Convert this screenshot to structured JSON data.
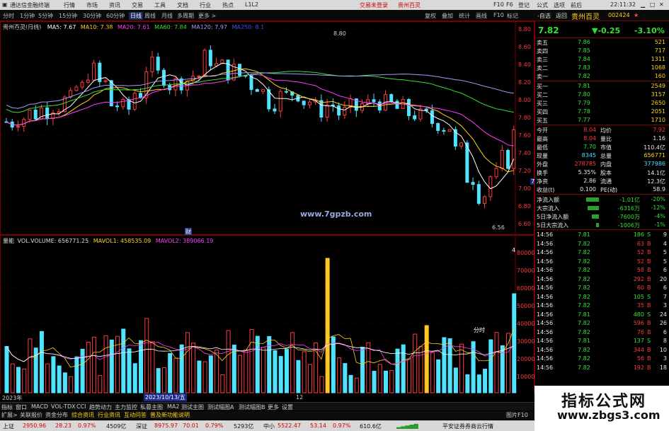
{
  "titlebar": {
    "app_name": "通达信金融终端",
    "menus": [
      "行情",
      "市场",
      "资讯",
      "交易",
      "工具",
      "文档",
      "行业",
      "热点",
      "L1L2"
    ],
    "login_link": "交易未登录",
    "stock_link": "贵州百灵",
    "right_menus": [
      "F10",
      "F6",
      "登记",
      "公式",
      "选项",
      "前后"
    ]
  },
  "periodbar": {
    "periods": [
      "分时",
      "1分钟",
      "5分钟",
      "15分钟",
      "30分钟",
      "60分钟",
      "日线",
      "周线",
      "月线",
      "多周期",
      "更多 >"
    ],
    "selected": "日线"
  },
  "right_top_bar": {
    "items": [
      "复权",
      "叠加",
      "统计",
      "画线",
      "F10",
      "标记",
      "-自选",
      "返回"
    ]
  },
  "main_chart": {
    "stock_label": "贵州百灵(日线)",
    "ma5": "MA5: 7.67",
    "ma10": "MA10: 7.38",
    "ma20": "MA20: 7.61",
    "ma60": "MA60: 7.84",
    "ma120": "MA120: 7.97",
    "ma250": "MA250: 8.1",
    "high_label": "8.80",
    "low_label": "6.56",
    "price_tag": "7.02",
    "marker_text": "财",
    "watermark": "www.7gpzb.com"
  },
  "axis_prices": [
    "8.80",
    "8.60",
    "8.40",
    "8.20",
    "8.00",
    "7.80",
    "7.60",
    "7.40",
    "7.20",
    "7.00",
    "6.80",
    "6.60"
  ],
  "vol_chart": {
    "legend_prefix": "量能",
    "volume": "VOL.VOLUME: 656771.25",
    "mavol1": "MAVOL1: 458535.09",
    "mavol2": "MAVOL2: 389066.19",
    "note_label": "分时",
    "spike_labels": [
      "4"
    ],
    "axis": [
      "80000",
      "70000",
      "60000",
      "50000",
      "40000",
      "30000",
      "20000",
      "10000"
    ]
  },
  "bottom_axis": {
    "left_year": "2023年",
    "date_highlight": "2023/10/13/五",
    "right_label": "12"
  },
  "tabs_row1": [
    "指标",
    "窗口",
    "MACD",
    "VOL-TDX",
    "CCI",
    "趋势动力",
    "主力监控",
    "私募主图",
    "MA2",
    "测试主图",
    "测试幅图A",
    "测试幅图B",
    "更多",
    "设置"
  ],
  "tabs_row2": [
    "扩展>",
    "关联报价",
    "资金分布",
    "综合资讯",
    "行业资讯",
    "互动问答",
    "普及新功能说明"
  ],
  "tabs_row2_right": "图片F10",
  "quote": {
    "name": "贵州百灵",
    "code": "002424",
    "price": "7.82",
    "change": "▼-0.25",
    "pct": "-3.10%",
    "asks": [
      {
        "label": "卖五",
        "price": "7.86",
        "vol": "521"
      },
      {
        "label": "卖四",
        "price": "7.85",
        "vol": "717"
      },
      {
        "label": "卖三",
        "price": "7.84",
        "vol": "1311"
      },
      {
        "label": "卖二",
        "price": "7.83",
        "vol": "1068"
      },
      {
        "label": "卖一",
        "price": "7.82",
        "vol": "160"
      }
    ],
    "bids": [
      {
        "label": "买一",
        "price": "7.81",
        "vol": "2549"
      },
      {
        "label": "买二",
        "price": "7.80",
        "vol": "3157"
      },
      {
        "label": "买三",
        "price": "7.79",
        "vol": "2650"
      },
      {
        "label": "买四",
        "price": "7.78",
        "vol": "2051"
      },
      {
        "label": "买五",
        "price": "7.77",
        "vol": "1710"
      }
    ],
    "stats": [
      {
        "l1": "今开",
        "v1": "8.04",
        "l2": "均价",
        "v2": "7.92"
      },
      {
        "l1": "最高",
        "v1": "8.04",
        "l2": "量比",
        "v2": "1.16"
      },
      {
        "l1": "最低",
        "v1": "7.70",
        "l2": "市值",
        "v2": "110.4亿"
      },
      {
        "l1": "现量",
        "v1": "8345",
        "l2": "总量",
        "v2": "656771"
      },
      {
        "l1": "外盘",
        "v1": "278785",
        "l2": "内盘",
        "v2": "377986"
      },
      {
        "l1": "换手",
        "v1": "5.35%",
        "l2": "股本",
        "v2": "14.1亿"
      },
      {
        "l1": "净资",
        "v1": "2.86",
        "l2": "流通",
        "v2": "12.3亿"
      },
      {
        "l1": "收益(t)",
        "v1": "0.100",
        "l2": "PE(动)",
        "v2": "58.9"
      }
    ],
    "flows": [
      {
        "label": "净流入额",
        "value": "-1.01亿",
        "pct": "-20%"
      },
      {
        "label": "大宗流入",
        "value": "-6316万",
        "pct": "-12%"
      },
      {
        "label": "5日净流入额",
        "value": "-7600万",
        "pct": "-4%"
      },
      {
        "label": "5日大宗流入",
        "value": "-1006万",
        "pct": "-1%"
      }
    ],
    "ticks": [
      {
        "t": "14:56",
        "p": "7.81",
        "v": "186",
        "d": "S",
        "n": "9"
      },
      {
        "t": "14:56",
        "p": "7.82",
        "v": "63",
        "d": "B",
        "n": "4"
      },
      {
        "t": "14:56",
        "p": "7.82",
        "v": "52",
        "d": "B",
        "n": "5"
      },
      {
        "t": "14:56",
        "p": "7.82",
        "v": "52",
        "d": "B",
        "n": "5"
      },
      {
        "t": "14:56",
        "p": "7.82",
        "v": "58",
        "d": "B",
        "n": "6"
      },
      {
        "t": "14:56",
        "p": "7.82",
        "v": "292",
        "d": "B",
        "n": "20"
      },
      {
        "t": "14:56",
        "p": "7.82",
        "v": "60",
        "d": "B",
        "n": "6"
      },
      {
        "t": "14:56",
        "p": "7.82",
        "v": "105",
        "d": "S",
        "n": "7"
      },
      {
        "t": "14:56",
        "p": "7.82",
        "v": "35",
        "d": "B",
        "n": "3"
      },
      {
        "t": "14:56",
        "p": "7.81",
        "v": "480",
        "d": "S",
        "n": "24"
      },
      {
        "t": "14:56",
        "p": "7.82",
        "v": "596",
        "d": "B",
        "n": "26"
      },
      {
        "t": "14:56",
        "p": "7.82",
        "v": "76",
        "d": "B",
        "n": "6"
      },
      {
        "t": "14:56",
        "p": "7.81",
        "v": "137",
        "d": "S",
        "n": "8"
      },
      {
        "t": "14:56",
        "p": "7.82",
        "v": "344",
        "d": "B",
        "n": "10"
      },
      {
        "t": "14:56",
        "p": "7.82",
        "v": "56",
        "d": "B",
        "n": "3"
      },
      {
        "t": "14:56",
        "p": "7.82",
        "v": "192",
        "d": "B",
        "n": "18"
      }
    ]
  },
  "status": {
    "sh_label": "上证",
    "sh_val": "2950.96",
    "sh_chg": "28.23",
    "sh_pct": "0.97%",
    "sh_amt": "4509亿",
    "sz_label": "深证",
    "sz_val": "8975.97",
    "sz_chg": "70.01",
    "sz_pct": "0.79%",
    "sz_amt": "5293亿",
    "zx_label": "中小",
    "zx_val": "5522.47",
    "zx_chg": "53.14",
    "zx_pct": "0.97%",
    "zx_amt": "610.6亿",
    "broker": "平安证券券商云行情"
  },
  "clock": "22:11:32",
  "brand": {
    "title": "指标公式网",
    "url": "www.zbgs3.com"
  },
  "colors": {
    "up": "#ff3b3b",
    "down": "#4fe3ff",
    "ma5": "#ffffff",
    "ma10": "#ffd21a",
    "ma20": "#ff3bff",
    "ma60": "#35e035",
    "ma120": "#9aa0ff",
    "ma250": "#3355ff"
  }
}
